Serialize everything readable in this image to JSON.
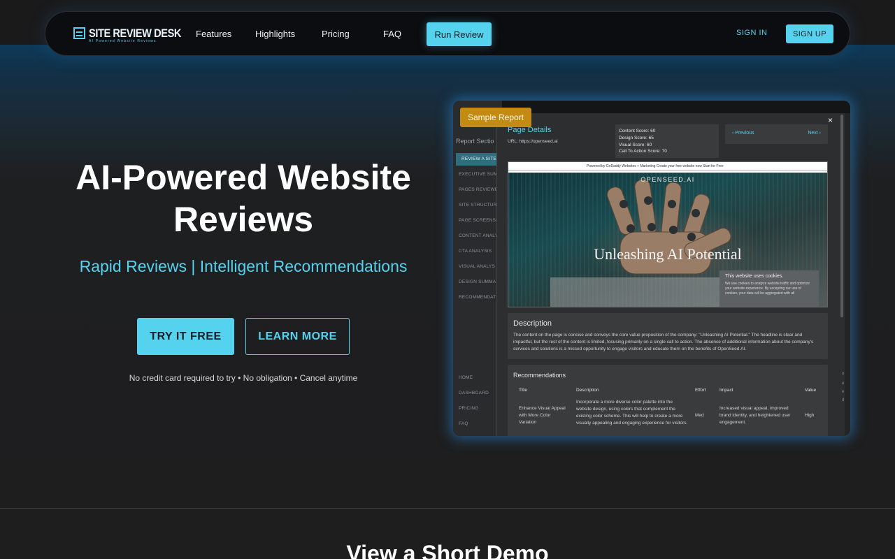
{
  "brand": {
    "name": "SITE REVIEW DESK",
    "tagline": "AI Powered Website Reviews"
  },
  "nav": {
    "links": [
      "Features",
      "Highlights",
      "Pricing",
      "FAQ"
    ],
    "run_review": "Run Review",
    "sign_in": "SIGN IN",
    "sign_up": "SIGN UP"
  },
  "hero": {
    "title": "AI-Powered Website Reviews",
    "subtitle": "Rapid Reviews | Intelligent Recommendations",
    "try_button": "TRY IT FREE",
    "learn_button": "LEARN MORE",
    "note": "No credit card required to try • No obligation • Cancel anytime"
  },
  "sample": {
    "badge": "Sample Report",
    "close_symbol": "×",
    "report_sidebar": {
      "title": "Report Sectio",
      "active_item": "REVIEW A SITE",
      "items": [
        "EXECUTIVE SUMM",
        "PAGES REVIEWE",
        "SITE STRUCTUR",
        "PAGE SCREENSH",
        "CONTENT ANALY",
        "CTA ANALYSIS",
        "VISUAL ANALYS",
        "DESIGN SUMMA",
        "RECOMMENDAT"
      ],
      "bottom_items": [
        "HOME",
        "DASHBOARD",
        "PRICING",
        "FAQ"
      ]
    },
    "page_details": {
      "title": "Page Details",
      "url": "URL: https://openseed.ai",
      "scores": [
        "Content Score: 60",
        "Design Score: 65",
        "Visual Score: 60",
        "Call To Action Score: 70"
      ],
      "prev": "Previous",
      "next": "Next"
    },
    "site_preview": {
      "topbar": "Powered by GoDaddy Websites + Marketing  Create your free website now   Start for Free",
      "brand": "OPENSEED.AI",
      "headline": "Unleashing AI Potential",
      "cookie_title": "This website uses cookies.",
      "cookie_text": "We use cookies to analyze website traffic and optimize your website experience. By accepting our use of cookies, your data will be aggregated with all"
    },
    "description": {
      "title": "Description",
      "text": "The content on the page is concise and conveys the core value proposition of the company: \"Unleashing AI Potential.\" The headline is clear and impactful, but the rest of the content is limited, focusing primarily on a single call to action. The absence of additional information about the company's services and solutions is a missed opportunity to engage visitors and educate them on the benefits of OpenSeed.AI."
    },
    "recommendations": {
      "title": "Recommendations",
      "headers": [
        "Title",
        "Description",
        "Effort",
        "Impact",
        "Value"
      ],
      "row": {
        "title": "Enhance Visual Appeal with More Color Variation",
        "description": "Incorporate a more diverse color palette into the website design, using colors that complement the existing color scheme. This will help to create a more visually appealing and engaging experience for visitors.",
        "effort": "Med",
        "impact": "Increased visual appeal, improved brand identity, and heightened user engagement.",
        "value": "High"
      }
    }
  },
  "demo": {
    "title": "View a Short Demo"
  },
  "colors": {
    "accent": "#54d2ee",
    "badge": "#c38b14",
    "background": "#1e1e1f"
  }
}
